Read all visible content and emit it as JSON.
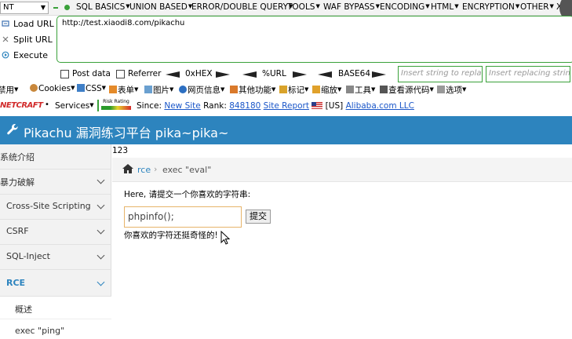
{
  "hackbar": {
    "select_value": "NT",
    "menus": [
      "SQL BASICS",
      "UNION BASED",
      "ERROR/DOUBLE QUERY",
      "TOOLS",
      "WAF BYPASS",
      "ENCODING",
      "HTML",
      "ENCRYPTION",
      "OTHER",
      "XSS"
    ],
    "actions": [
      "Load URL",
      "Split URL",
      "Execute"
    ],
    "url_value": "http://test.xiaodi8.com/pikachu",
    "checkboxes": [
      "Post data",
      "Referrer"
    ],
    "encoders": [
      "0xHEX",
      "%URL",
      "BASE64"
    ],
    "insert_placeholder": "Insert string to replace",
    "replacing_placeholder": "Insert replacing string"
  },
  "toolbar": {
    "items": [
      "禁用",
      "Cookies",
      "CSS",
      "表单",
      "图片",
      "网页信息",
      "其他功能",
      "标记",
      "缩放",
      "工具",
      "查看源代码",
      "选项"
    ]
  },
  "netcraft": {
    "logo": "NETCRAFT",
    "services": "Services",
    "risk": "Risk Rating",
    "since_label": "Since:",
    "since_value": "New Site",
    "rank_label": "Rank:",
    "rank_value": "848180",
    "site_report": "Site Report",
    "country": "[US]",
    "host": "Alibaba.com LLC"
  },
  "header": {
    "title": "Pikachu 漏洞练习平台 pika~pika~"
  },
  "sidebar": {
    "items": [
      {
        "label": "系统介绍",
        "has_chevron": false
      },
      {
        "label": "暴力破解",
        "has_chevron": true
      },
      {
        "label": "Cross-Site Scripting",
        "has_chevron": true
      },
      {
        "label": "CSRF",
        "has_chevron": true
      },
      {
        "label": "SQL-Inject",
        "has_chevron": true
      },
      {
        "label": "RCE",
        "has_chevron": true,
        "active": true
      }
    ],
    "subitems": [
      "概述",
      "exec \"ping\""
    ]
  },
  "main": {
    "output_text": "123",
    "breadcrumb_parent": "rce",
    "breadcrumb_current": "exec \"eval\"",
    "prompt": "Here, 请提交一个你喜欢的字符串:",
    "input_value": "phpinfo();",
    "submit_label": "提交",
    "result": "你喜欢的字符还挺奇怪的!"
  },
  "colors": {
    "accent": "#2d84be",
    "hackbar_green": "#3aa13a"
  }
}
